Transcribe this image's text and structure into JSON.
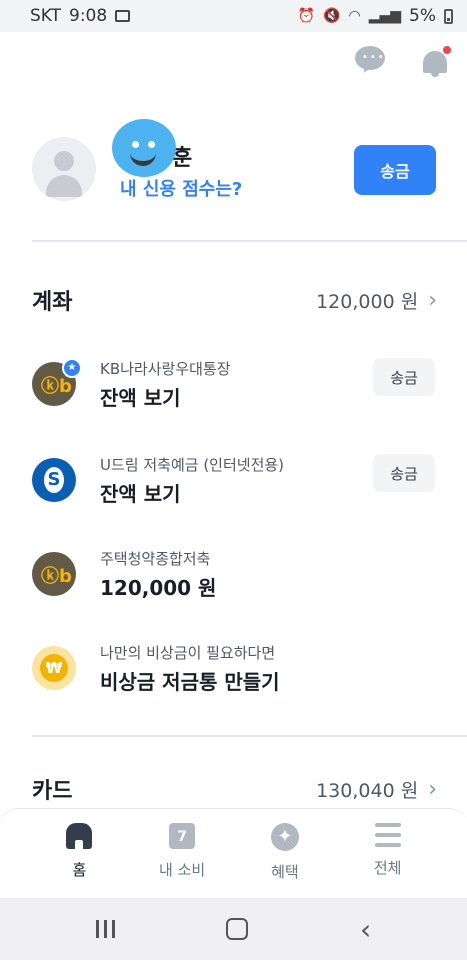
{
  "status_bar": {
    "carrier": "SKT",
    "time": "9:08",
    "battery": "5%"
  },
  "header": {
    "chat_icon": "chat-bubble-icon",
    "bell_icon": "bell-icon"
  },
  "profile": {
    "name_partial": "훈",
    "credit_link": "내 신용 점수는?",
    "send_label": "송금"
  },
  "accounts_section": {
    "title": "계좌",
    "total": "120,000 원",
    "items": [
      {
        "name": "KB나라사랑우대통장",
        "value": "잔액 보기",
        "button": "송금"
      },
      {
        "name": "U드림 저축예금 (인터넷전용)",
        "value": "잔액 보기",
        "button": "송금"
      },
      {
        "name": "주택청약종합저축",
        "value": "120,000 원"
      },
      {
        "name": "나만의 비상금이 필요하다면",
        "value": "비상금 저금통 만들기"
      }
    ]
  },
  "cards_section": {
    "title": "카드",
    "total": "130,040 원"
  },
  "tabs": [
    {
      "label": "홈",
      "icon": "home-icon",
      "active": true
    },
    {
      "label": "내 소비",
      "icon": "calendar-icon",
      "badge": "7"
    },
    {
      "label": "혜택",
      "icon": "sparkle-icon"
    },
    {
      "label": "전체",
      "icon": "menu-icon"
    }
  ],
  "colors": {
    "accent": "#3182f6",
    "kb": "#625947",
    "shinhan": "#0a5fb4"
  }
}
